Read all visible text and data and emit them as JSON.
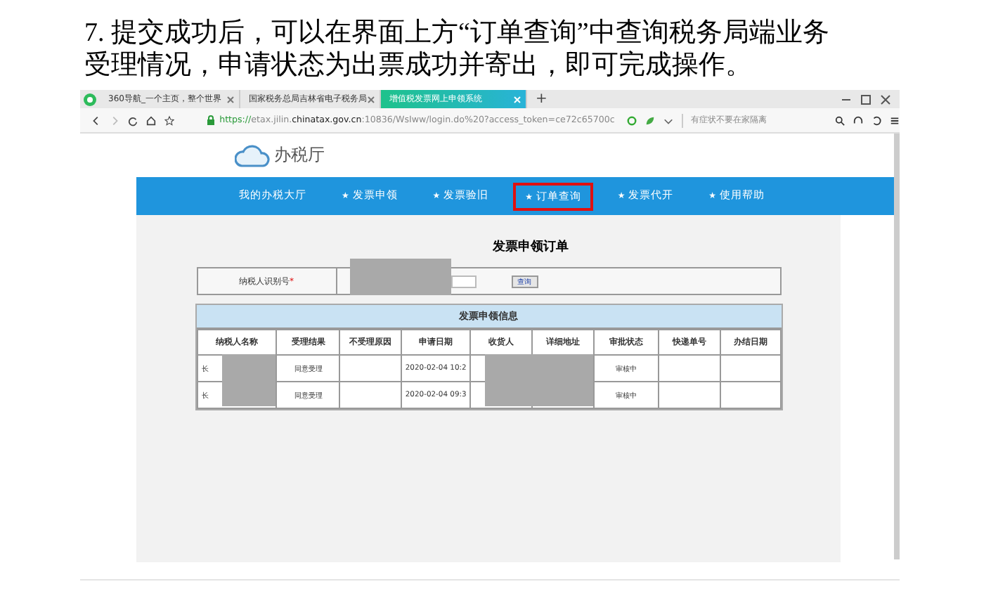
{
  "document_text": "7. 提交成功后，可以在界面上方“订单查询”中查询税务局端业务受理情况，申请状态为出票成功并寄出，即可完成操作。",
  "browser": {
    "tabs": [
      {
        "label": "360导航_一个主页，整个世界",
        "selected": false
      },
      {
        "label": "国家税务总局吉林省电子税务局",
        "selected": false
      },
      {
        "label": "增值税发票网上申领系统",
        "selected": true
      }
    ],
    "new_tab": "+",
    "address": {
      "scheme": "https://",
      "host_start": "etax.jilin.",
      "host_main": "chinatax.gov.cn",
      "rest": ":10836/WsIww/login.do%20?access_token=ce72c65700c"
    },
    "search": {
      "placeholder": "有症状不要在家隔离"
    }
  },
  "site": {
    "logo_text": "办税厅",
    "nav": [
      {
        "label": "我的办税大厅",
        "selected": false
      },
      {
        "label": "发票申领",
        "icon": "★",
        "selected": false
      },
      {
        "label": "发票验旧",
        "icon": "★",
        "selected": false
      },
      {
        "label": "订单查询",
        "icon": "★",
        "selected": true
      },
      {
        "label": "发票代开",
        "icon": "★",
        "selected": false
      },
      {
        "label": "使用帮助",
        "icon": "★",
        "selected": false
      }
    ],
    "title": "发票申领订单",
    "form": {
      "label": "纳税人识别号",
      "required_mark": "*",
      "button": "查询"
    },
    "table": {
      "title": "发票申领信息",
      "columns": [
        "纳税人名称",
        "受理结果",
        "不受理原因",
        "申请日期",
        "收货人",
        "详细地址",
        "审批状态",
        "快递单号",
        "办结日期"
      ],
      "rows": [
        [
          "长",
          "同意受理",
          "",
          "2020-02-04 10:2",
          "",
          "",
          "审核中",
          "",
          ""
        ],
        [
          "长",
          "同意受理",
          "",
          "2020-02-04 09:3",
          "",
          "",
          "审核中",
          "",
          ""
        ]
      ]
    }
  }
}
